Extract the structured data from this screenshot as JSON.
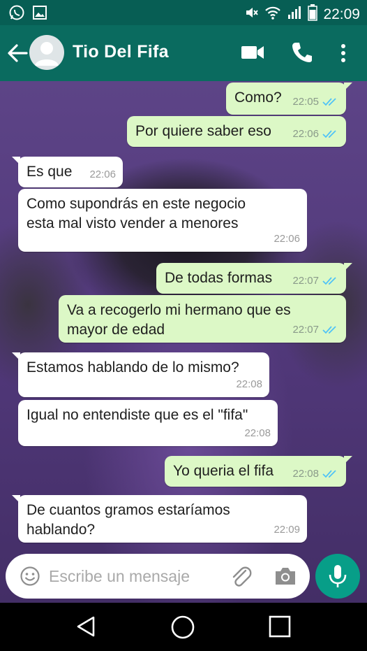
{
  "status_bar": {
    "time": "22:09",
    "left_icons": [
      "whatsapp-icon",
      "image-icon"
    ],
    "right_icons": [
      "mute-icon",
      "wifi-icon",
      "signal-icon",
      "battery-icon"
    ]
  },
  "header": {
    "contact_name": "Tio Del Fifa",
    "icons": [
      "back-arrow-icon",
      "avatar-icon",
      "video-call-icon",
      "phone-icon",
      "more-vert-icon"
    ]
  },
  "messages": [
    {
      "direction": "out",
      "text": "Como?",
      "time": "22:05",
      "status": "read"
    },
    {
      "direction": "out",
      "text": "Por quiere saber eso",
      "time": "22:06",
      "status": "read"
    },
    {
      "direction": "in",
      "text": "Es que",
      "time": "22:06"
    },
    {
      "direction": "in",
      "text": "Como supondrás en este negocio",
      "text2": "esta mal visto vender a menores",
      "time": "22:06"
    },
    {
      "direction": "out",
      "text": "De todas formas",
      "time": "22:07",
      "status": "read"
    },
    {
      "direction": "out",
      "text": "Va a recogerlo mi hermano que es",
      "text2": "mayor de edad",
      "time": "22:07",
      "status": "read"
    },
    {
      "direction": "in",
      "text": "Estamos hablando de lo mismo?",
      "time": "22:08"
    },
    {
      "direction": "in",
      "text": "Igual no entendiste que es el \"fifa\"",
      "time": "22:08"
    },
    {
      "direction": "out",
      "text": "Yo queria el fifa",
      "time": "22:08",
      "status": "read"
    },
    {
      "direction": "in",
      "text": "De cuantos gramos estaríamos",
      "text2": "hablando?",
      "time": "22:09"
    }
  ],
  "composer": {
    "placeholder": "Escribe un mensaje",
    "value": "",
    "icons": [
      "emoji-icon",
      "attach-icon",
      "camera-icon",
      "mic-icon"
    ]
  },
  "nav": {
    "icons": [
      "nav-back-icon",
      "nav-home-icon",
      "nav-recents-icon"
    ]
  },
  "colors": {
    "header": "#0a6b5f",
    "status_bar": "#075e54",
    "outgoing_bubble": "#dcf8c6",
    "incoming_bubble": "#ffffff",
    "read_ticks": "#4fc3f7",
    "mic_button": "#079e88"
  }
}
